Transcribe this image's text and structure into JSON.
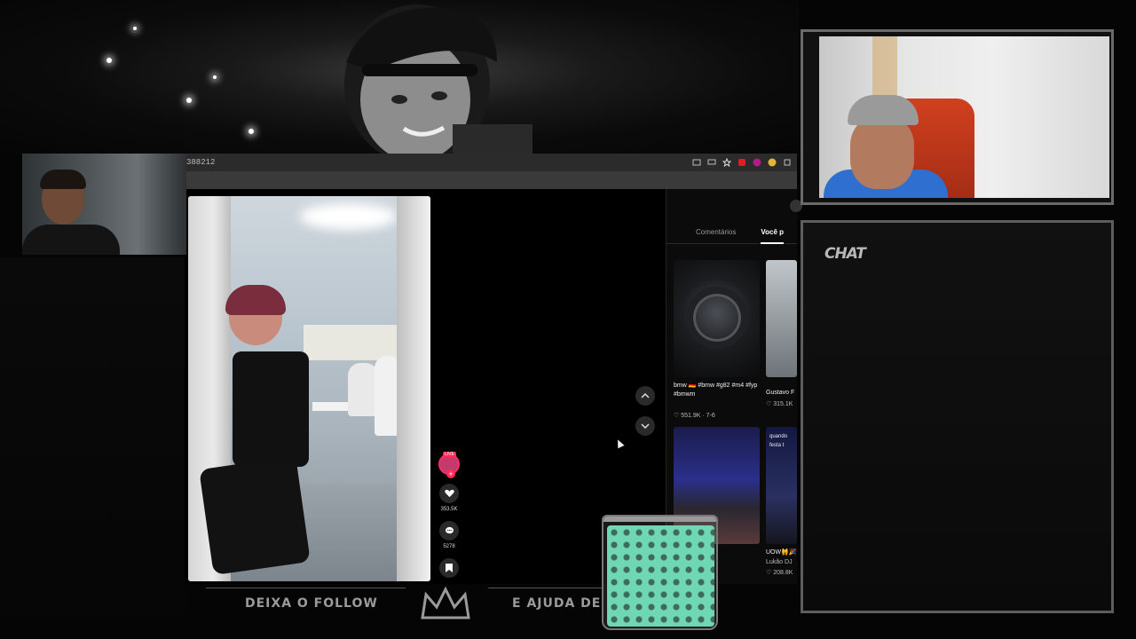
{
  "browser": {
    "url_fragment": "388212"
  },
  "video": {
    "live_badge": "LIVE",
    "likes": "353.5K",
    "comments": "5278"
  },
  "panel": {
    "tabs": [
      "Comentários",
      "Você p"
    ],
    "thumbs": [
      {
        "caption": "bmw 🇩🇪 #bmw #g82 #m4 #fyp #bmwm",
        "meta": "♡ 551.9K · 7-6"
      },
      {
        "caption": "Gustavo F",
        "meta": "♡ 315.1K"
      },
      {
        "caption": "UOW🙀🎉",
        "meta": "Lukão DJ"
      },
      {
        "caption": "",
        "meta": "♡ 208.8K"
      }
    ],
    "night_overlay": "quando festa t"
  },
  "overlay": {
    "chat_title": "CHAT",
    "banner_left": "DEIXA O FOLLOW",
    "banner_right": "E AJUDA DE"
  },
  "colors": {
    "accent_pink": "#fe2c55",
    "jar_green": "#6fd7b3",
    "chair_red": "#d0401e"
  }
}
